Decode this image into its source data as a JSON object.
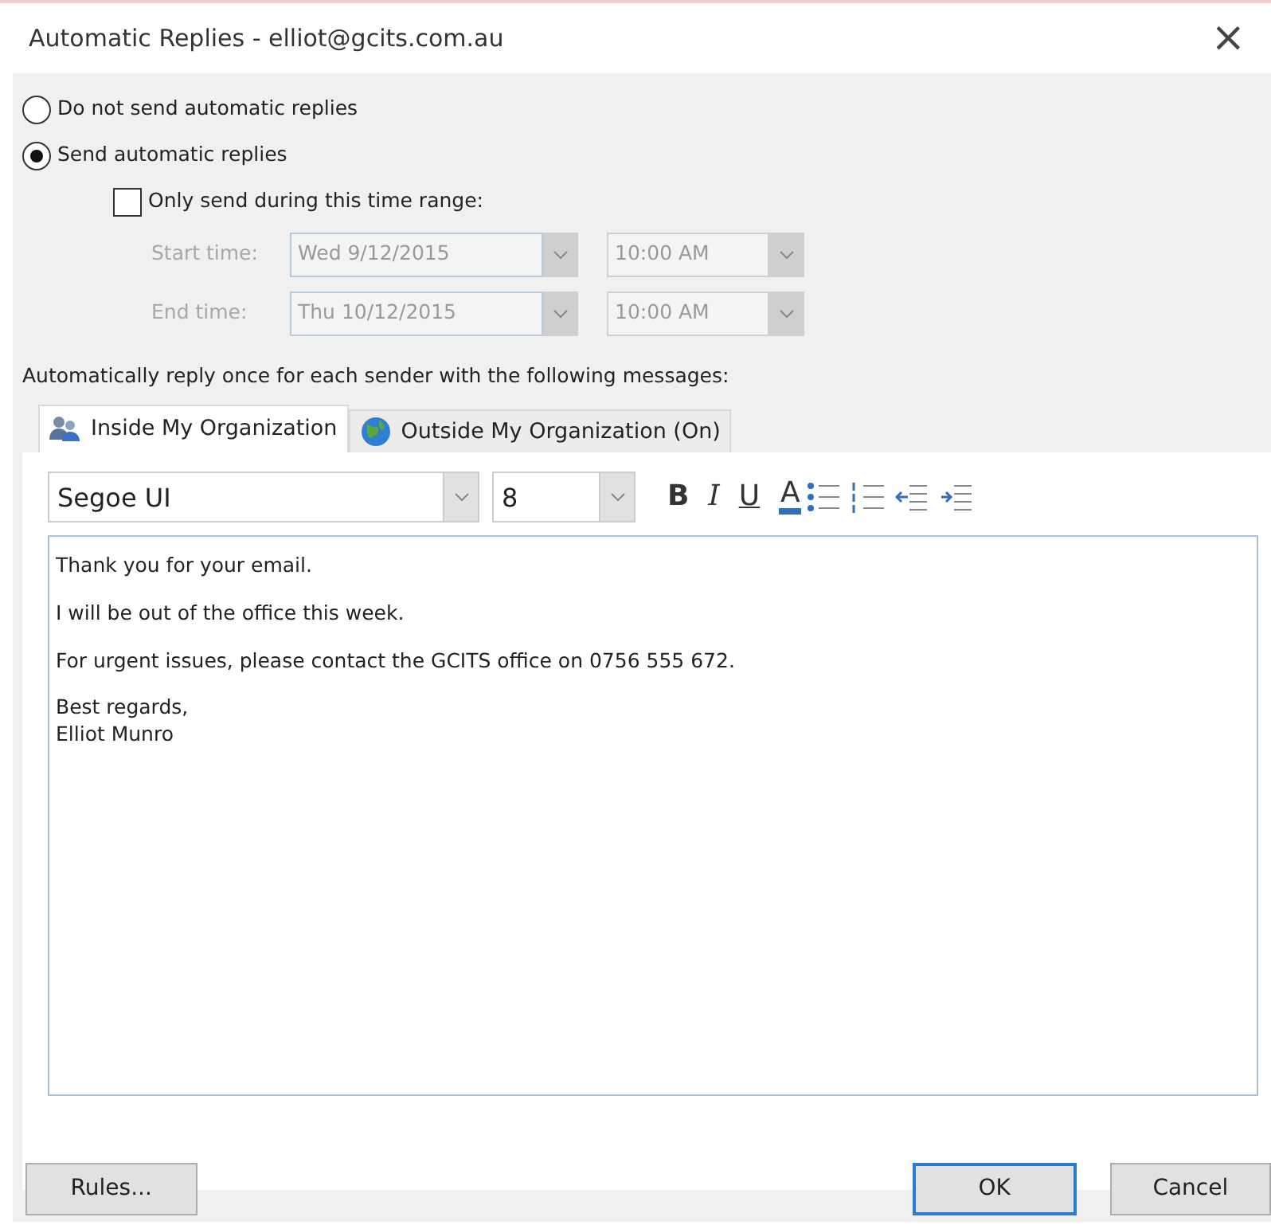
{
  "window": {
    "title": "Automatic Replies - elliot@gcits.com.au",
    "close": "×"
  },
  "reply_mode": [
    {
      "label": "Do not send automatic replies",
      "selected": false
    },
    {
      "label": "Send automatic replies",
      "selected": true
    }
  ],
  "time_range": {
    "label": "Only send during this time range:",
    "checked": false,
    "disabled": true,
    "rows": [
      {
        "label": "Start time:",
        "date": "Wed 9/12/2015",
        "time": "10:00 AM"
      },
      {
        "label": "End time:",
        "date": "Thu 10/12/2015",
        "time": "10:00 AM"
      }
    ]
  },
  "instruction": "Automatically reply once for each sender with the following messages:",
  "tabs": [
    {
      "label": "Inside My Organization",
      "kind": "people",
      "selected": true
    },
    {
      "label": "Outside My Organization (On)",
      "kind": "globe",
      "selected": false
    }
  ],
  "toolbar": {
    "font": "Segoe UI",
    "size": "8",
    "buttons": [
      {
        "kind": "bold",
        "label": "B"
      },
      {
        "kind": "italic",
        "label": "I"
      },
      {
        "kind": "underline",
        "label": "U"
      },
      {
        "kind": "font-color",
        "label": "A"
      },
      {
        "kind": "bullets"
      },
      {
        "kind": "numbering"
      },
      {
        "kind": "outdent"
      },
      {
        "kind": "indent"
      }
    ]
  },
  "message": [
    "Thank you for your email.",
    "I will be out of the office this week.",
    "For urgent issues, please contact the GCITS office on 0756 555 672.",
    "Best regards,\nElliot Munro"
  ],
  "buttons": [
    {
      "label": "Rules...",
      "default": false
    },
    {
      "label": "OK",
      "default": true
    },
    {
      "label": "Cancel",
      "default": false
    }
  ]
}
